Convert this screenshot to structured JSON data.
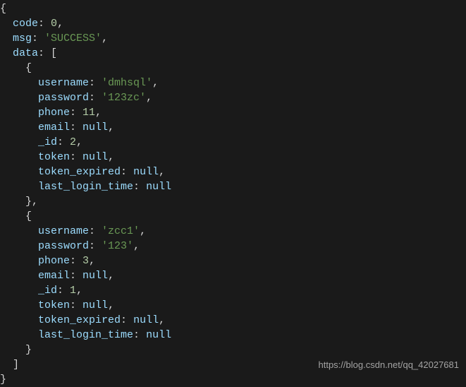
{
  "root_open": "{",
  "root_close": "}",
  "bracket_open": "[",
  "bracket_close": "]",
  "brace_open": "{",
  "brace_close": "}",
  "brace_close_comma": "},",
  "keys": {
    "code": "code",
    "msg": "msg",
    "data": "data",
    "username": "username",
    "password": "password",
    "phone": "phone",
    "email": "email",
    "id": "_id",
    "token": "token",
    "token_expired": "token_expired",
    "last_login_time": "last_login_time"
  },
  "top": {
    "code": "0",
    "msg": "'SUCCESS'"
  },
  "items": [
    {
      "username": "'dmhsql'",
      "password": "'123zc'",
      "phone": "11",
      "email": "null",
      "id": "2",
      "token": "null",
      "token_expired": "null",
      "last_login_time": "null"
    },
    {
      "username": "'zcc1'",
      "password": "'123'",
      "phone": "3",
      "email": "null",
      "id": "1",
      "token": "null",
      "token_expired": "null",
      "last_login_time": "null"
    }
  ],
  "watermark": "https://blog.csdn.net/qq_42027681",
  "punct": {
    "colon": ": ",
    "comma": ","
  }
}
